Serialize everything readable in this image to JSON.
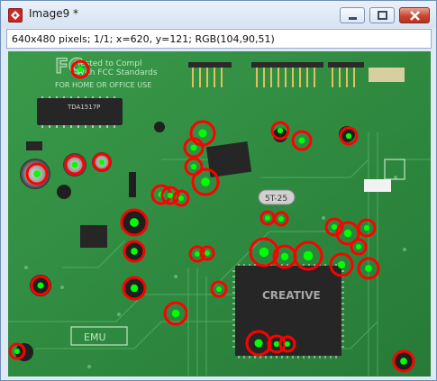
{
  "window": {
    "title": "Image9 *",
    "icon": "imagej-app-icon",
    "controls": [
      "minimize",
      "maximize",
      "close"
    ]
  },
  "info": {
    "text": "640x480 pixels; 1/1; x=620, y=121; RGB(104,90,51)"
  },
  "image": {
    "description_icon": "pcb-photo",
    "board_text": {
      "fcc_line1": "Tested to Compl",
      "fcc_line2": "With FCC Standards",
      "fcc_line3": "FOR HOME OR OFFICE USE",
      "fcc_logo": "FC",
      "chip_brand": "CREATIVE",
      "crystal": "5T-25",
      "ic_label": "TDA1517P",
      "emu": "EMU"
    },
    "colors": {
      "pcb": "#2f8a40",
      "marker_ring": "#ff0000",
      "marker_center": "#00ff00",
      "chip": "#2a2a2a"
    }
  }
}
